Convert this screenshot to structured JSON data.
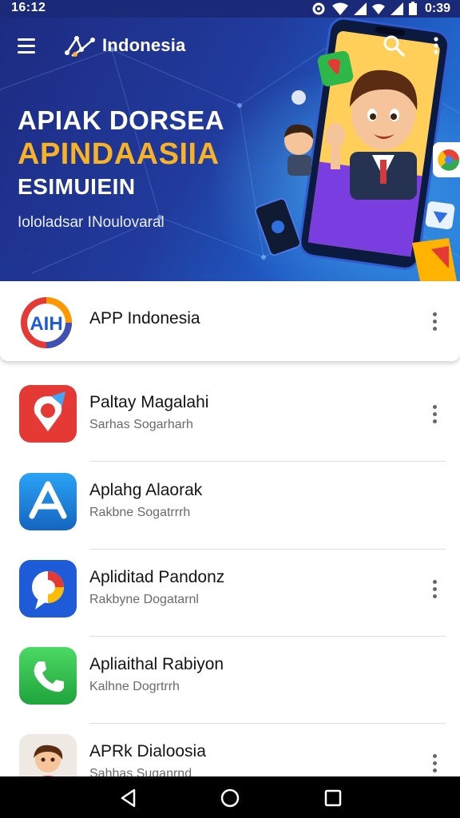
{
  "status_bar": {
    "time_left": "16:12",
    "time_right": "0:39"
  },
  "app_bar": {
    "title": "Indonesia",
    "icons": {
      "menu": "menu-icon",
      "logo": "network-logo-icon",
      "search": "search-icon",
      "more": "more-vertical-icon"
    }
  },
  "banner": {
    "headline_1": "APIAK DORSEA",
    "headline_2": "APINDAASIIA",
    "headline_3": "ESIMUIEIN",
    "subtitle": "Iololadsar INoulovaral",
    "colors": {
      "background": "#213a9c",
      "accent": "#f7b325"
    }
  },
  "featured": {
    "icon_text": "AIH",
    "name": "APP Indonesia"
  },
  "apps": [
    {
      "title": "Paltay Magalahi",
      "subtitle": "Sarhas Sogarharh",
      "icon": "location-pin-icon",
      "color": "#e53935",
      "menu": true
    },
    {
      "title": "Aplahg Alaorak",
      "subtitle": "Rakbne Sogatrrrh",
      "icon": "app-store-icon",
      "color": "#1e88e5",
      "menu": false
    },
    {
      "title": "Apliditad Pandonz",
      "subtitle": "Rakbyne Dogatarnl",
      "icon": "chat-bubble-icon",
      "color": "#1e5bd8",
      "menu": true
    },
    {
      "title": "Apliaithal Rabiyon",
      "subtitle": "Kalhne Dogrtrrh",
      "icon": "phone-icon",
      "color": "#2fb84a",
      "menu": false
    },
    {
      "title": "APRk Dialoosia",
      "subtitle": "Sahhas Suganrnd",
      "icon": "avatar-icon",
      "color": "#e8e2dc",
      "menu": true
    }
  ],
  "nav": {
    "back": "back-icon",
    "home": "home-icon",
    "recents": "recents-icon"
  }
}
